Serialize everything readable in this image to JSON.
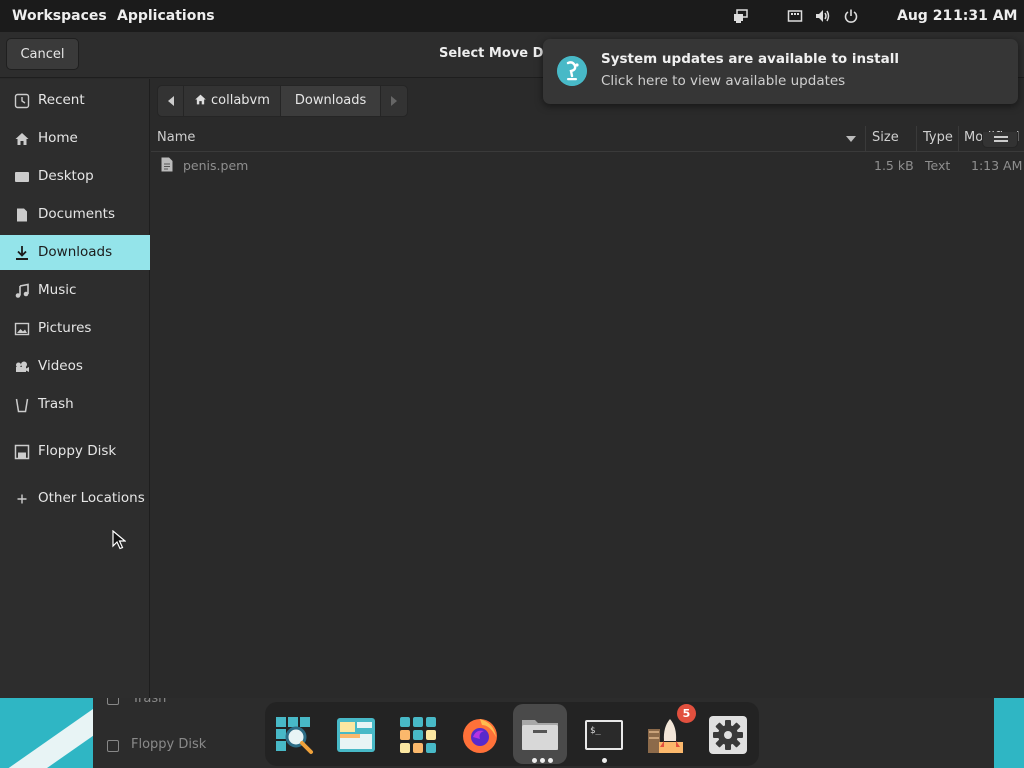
{
  "top_panel": {
    "workspaces": "Workspaces",
    "applications": "Applications",
    "date": "Aug 21",
    "time": "1:31 AM",
    "tray_icons": [
      "display-icon",
      "keyboard-icon",
      "volume-icon",
      "power-icon"
    ]
  },
  "dialog": {
    "title": "Select Move Dest",
    "cancel_label": "Cancel"
  },
  "sidebar": {
    "items": [
      {
        "label": "Recent",
        "icon": "clock-icon"
      },
      {
        "label": "Home",
        "icon": "home-icon"
      },
      {
        "label": "Desktop",
        "icon": "desktop-icon"
      },
      {
        "label": "Documents",
        "icon": "document-icon"
      },
      {
        "label": "Downloads",
        "icon": "download-icon",
        "active": true
      },
      {
        "label": "Music",
        "icon": "music-icon"
      },
      {
        "label": "Pictures",
        "icon": "pictures-icon"
      },
      {
        "label": "Videos",
        "icon": "videos-icon"
      },
      {
        "label": "Trash",
        "icon": "trash-icon"
      },
      {
        "label": "Floppy Disk",
        "icon": "floppy-icon"
      },
      {
        "label": "Other Locations",
        "icon": "plus-icon"
      }
    ]
  },
  "pathbar": {
    "segments": [
      "collabvm",
      "Downloads"
    ]
  },
  "file_list": {
    "columns": [
      "Name",
      "Size",
      "Type",
      "Modified"
    ],
    "rows": [
      {
        "name": "penis.pem",
        "size": "1.5 kB",
        "type": "Text",
        "modified": "1:13 AM"
      }
    ]
  },
  "notification": {
    "title": "System updates are available to install",
    "body": "Click here to view available updates"
  },
  "background": {
    "items": [
      "Trash",
      "Floppy Disk"
    ]
  },
  "dock": {
    "apps": [
      "search-icon",
      "files-window-icon",
      "app-grid-icon",
      "firefox-icon",
      "file-manager-icon",
      "terminal-icon",
      "update-rocket-icon",
      "settings-icon"
    ],
    "badge": "5"
  },
  "colors": {
    "accent": "#94e4ea",
    "panel": "#1b1b1b",
    "badge": "#e2503e"
  }
}
